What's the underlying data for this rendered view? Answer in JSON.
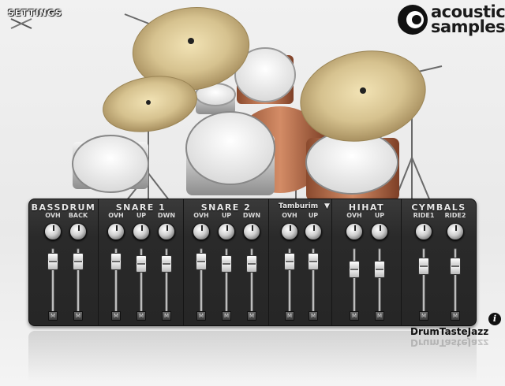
{
  "settings": {
    "label": "SETTINGS"
  },
  "logo": {
    "line1": "acoustic",
    "line2": "samples"
  },
  "brand": {
    "name": "DrumTasteJazz"
  },
  "info_label": "i",
  "colors": {
    "panel": "#2b2b2b",
    "cymbal": "#d6c28f",
    "shell": "#c77a55"
  },
  "mixer": {
    "groups": [
      {
        "title": "Bassdrum",
        "channels": [
          {
            "label": "OVH",
            "level": 0.9
          },
          {
            "label": "BACK",
            "level": 0.9
          }
        ]
      },
      {
        "title": "Snare 1",
        "channels": [
          {
            "label": "OVH",
            "level": 0.9
          },
          {
            "label": "UP",
            "level": 0.85
          },
          {
            "label": "DWN",
            "level": 0.85
          }
        ]
      },
      {
        "title": "Snare 2",
        "channels": [
          {
            "label": "OVH",
            "level": 0.9
          },
          {
            "label": "UP",
            "level": 0.85
          },
          {
            "label": "DWN",
            "level": 0.85
          }
        ]
      },
      {
        "title": "Tamburim",
        "dropdown": true,
        "channels": [
          {
            "label": "OVH",
            "level": 0.9
          },
          {
            "label": "UP",
            "level": 0.9
          }
        ]
      },
      {
        "title": "Hihat",
        "channels": [
          {
            "label": "OVH",
            "level": 0.75
          },
          {
            "label": "UP",
            "level": 0.75
          }
        ]
      },
      {
        "title": "Cymbals",
        "channels": [
          {
            "label": "RIDE1",
            "level": 0.8
          },
          {
            "label": "RIDE2",
            "level": 0.8
          }
        ]
      }
    ],
    "mute_label": "M"
  }
}
